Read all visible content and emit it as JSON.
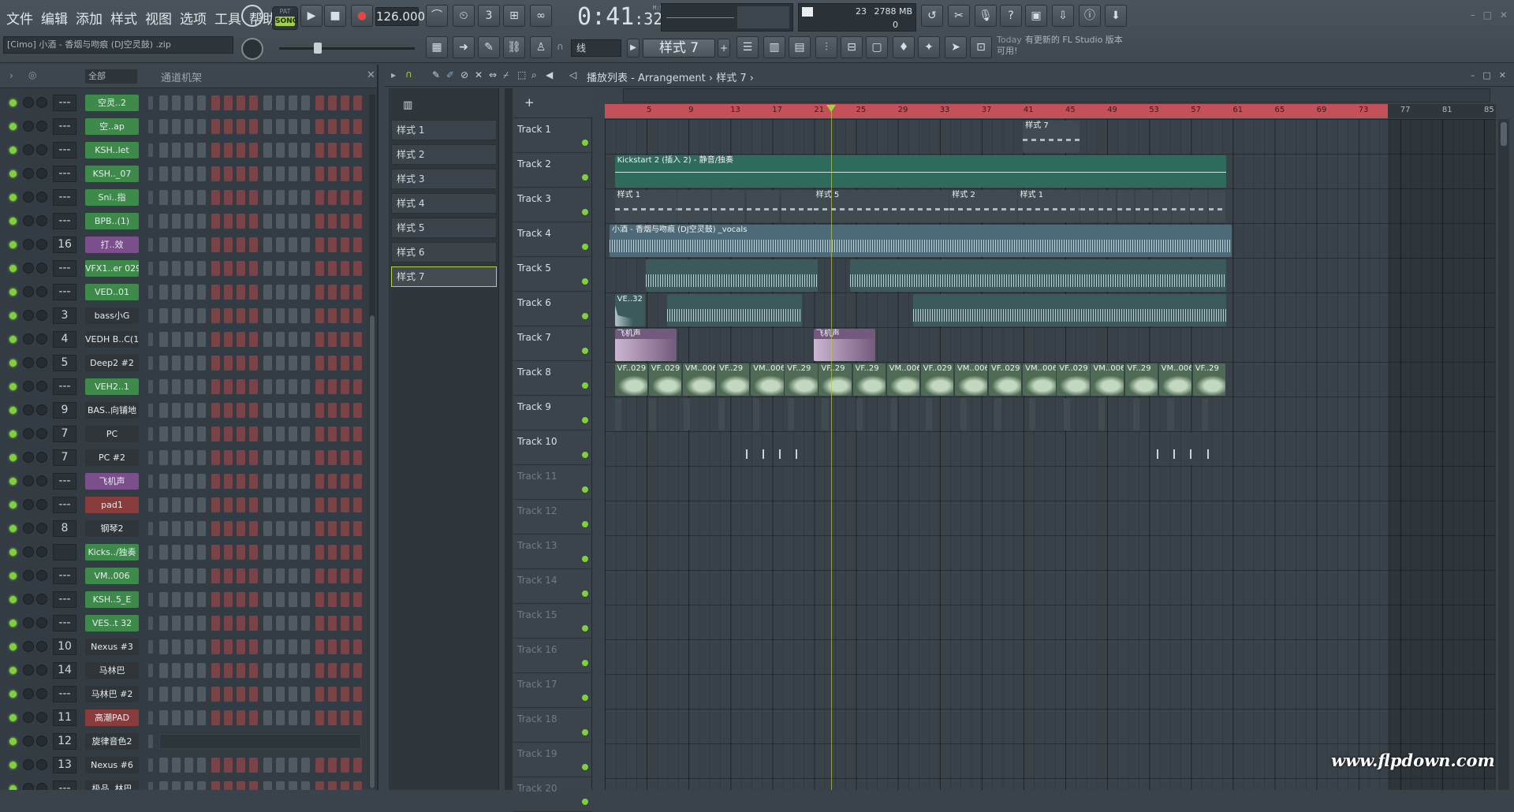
{
  "menu": [
    "文件",
    "编辑",
    "添加",
    "样式",
    "视图",
    "选项",
    "工具",
    "帮助"
  ],
  "song_info": "[Cimo] 小酒 - 香烟与吻痕 (DJ空灵鼓) .zip",
  "transport": {
    "mode_pattern": "PAT",
    "mode_song": "SONG",
    "tempo": "126.000",
    "time_main": "0:41",
    "time_sub": ":32",
    "time_format": "M:S:CS"
  },
  "cpu": {
    "value1": "23",
    "memory": "2788 MB",
    "value3": "0"
  },
  "snap": "线",
  "pattern_selector": "样式 7",
  "news": {
    "today": "Today",
    "text": "有更新的 FL Studio 版本可用!"
  },
  "channel_rack": {
    "filter": "全部",
    "title": "通道机架",
    "channels": [
      {
        "mix": "---",
        "name": "空灵..2",
        "color": "#3d8a4a",
        "type": "steps"
      },
      {
        "mix": "---",
        "name": "空..ap",
        "color": "#3d8a4a",
        "type": "steps"
      },
      {
        "mix": "---",
        "name": "KSH..let",
        "color": "#3d8a4a",
        "type": "steps"
      },
      {
        "mix": "---",
        "name": "KSH.._07",
        "color": "#3d8a4a",
        "type": "steps"
      },
      {
        "mix": "---",
        "name": "Sni..指",
        "color": "#3d8a4a",
        "type": "steps"
      },
      {
        "mix": "---",
        "name": "BPB..(1)",
        "color": "#3d8a4a",
        "type": "steps"
      },
      {
        "mix": "16",
        "name": "打..效",
        "color": "#7a4f8c",
        "type": "steps"
      },
      {
        "mix": "---",
        "name": "VFX1..er 029",
        "color": "#3d8a4a",
        "type": "steps"
      },
      {
        "mix": "---",
        "name": "VED..01",
        "color": "#3d8a4a",
        "type": "steps"
      },
      {
        "mix": "3",
        "name": "bass小G",
        "color": "#2f3539",
        "type": "steps"
      },
      {
        "mix": "4",
        "name": "VEDH B..C(1)",
        "color": "#2f3539",
        "type": "steps"
      },
      {
        "mix": "5",
        "name": "Deep2 #2",
        "color": "#2f3539",
        "type": "steps"
      },
      {
        "mix": "---",
        "name": "VEH2..1",
        "color": "#3d8a4a",
        "type": "steps"
      },
      {
        "mix": "9",
        "name": "BAS..向铺地",
        "color": "#2f3539",
        "type": "steps"
      },
      {
        "mix": "7",
        "name": "PC",
        "color": "#2f3539",
        "type": "steps"
      },
      {
        "mix": "7",
        "name": "PC #2",
        "color": "#2f3539",
        "type": "steps"
      },
      {
        "mix": "---",
        "name": "飞机声",
        "color": "#7a4f8c",
        "type": "steps"
      },
      {
        "mix": "---",
        "name": "pad1",
        "color": "#8a3b3b",
        "type": "steps"
      },
      {
        "mix": "8",
        "name": "钢琴2",
        "color": "#2f3539",
        "type": "steps"
      },
      {
        "mix": "",
        "name": "Kicks../独奏",
        "color": "#3d8a4a",
        "type": "steps"
      },
      {
        "mix": "---",
        "name": "VM..006",
        "color": "#3d8a4a",
        "type": "steps"
      },
      {
        "mix": "---",
        "name": "KSH..5_E",
        "color": "#3d8a4a",
        "type": "steps"
      },
      {
        "mix": "---",
        "name": "VES..t 32",
        "color": "#3d8a4a",
        "type": "steps"
      },
      {
        "mix": "10",
        "name": "Nexus #3",
        "color": "#2f3539",
        "type": "steps"
      },
      {
        "mix": "14",
        "name": "马林巴",
        "color": "#2f3539",
        "type": "steps"
      },
      {
        "mix": "---",
        "name": "马林巴 #2",
        "color": "#2f3539",
        "type": "steps"
      },
      {
        "mix": "11",
        "name": "高潮PAD",
        "color": "#8a3b3b",
        "type": "steps"
      },
      {
        "mix": "12",
        "name": "旋律音色2",
        "color": "#2f3539",
        "type": "pianoroll"
      },
      {
        "mix": "13",
        "name": "Nexus #6",
        "color": "#2f3539",
        "type": "steps"
      },
      {
        "mix": "---",
        "name": "极品..林巴",
        "color": "#2f3539",
        "type": "steps"
      }
    ]
  },
  "playlist": {
    "title": "播放列表 - Arrangement › 样式 7 ›",
    "patterns": [
      "样式 1",
      "样式 2",
      "样式 3",
      "样式 4",
      "样式 5",
      "样式 6",
      "样式 7"
    ],
    "active_pattern": 6,
    "ruler_bars": [
      "5",
      "9",
      "13",
      "17",
      "21",
      "25",
      "29",
      "33",
      "37",
      "41",
      "45",
      "49",
      "53",
      "57",
      "61",
      "65",
      "69",
      "73",
      "77",
      "81",
      "85"
    ],
    "tracks": [
      "Track 1",
      "Track 2",
      "Track 3",
      "Track 4",
      "Track 5",
      "Track 6",
      "Track 7",
      "Track 8",
      "Track 9",
      "Track 10",
      "Track 11",
      "Track 12",
      "Track 13",
      "Track 14",
      "Track 15",
      "Track 16",
      "Track 17",
      "Track 18",
      "Track 19",
      "Track 20"
    ],
    "clip_labels": {
      "t1": "样式 7",
      "t2": "Kickstart 2 (插入 2) - 静音/独奏",
      "t3a": "样式 1",
      "t3b": "样式 5",
      "t3c": "样式 2",
      "t3d": "样式 1",
      "t4": "小酒 - 香烟与吻痕 (DJ空灵鼓) _vocals",
      "t6": "VE..32",
      "t7": "飞机声",
      "t8a": "VF..029",
      "t8b": "VM..006",
      "t8c": "VF..29"
    }
  },
  "colors": {
    "accent_green": "#9fd23e",
    "loop_red": "#c4505a",
    "clip_teal": "#2f6b5c",
    "clip_blue": "#4d6a78",
    "clip_purple": "#735a7d"
  },
  "watermark": "www.flpdown.com"
}
